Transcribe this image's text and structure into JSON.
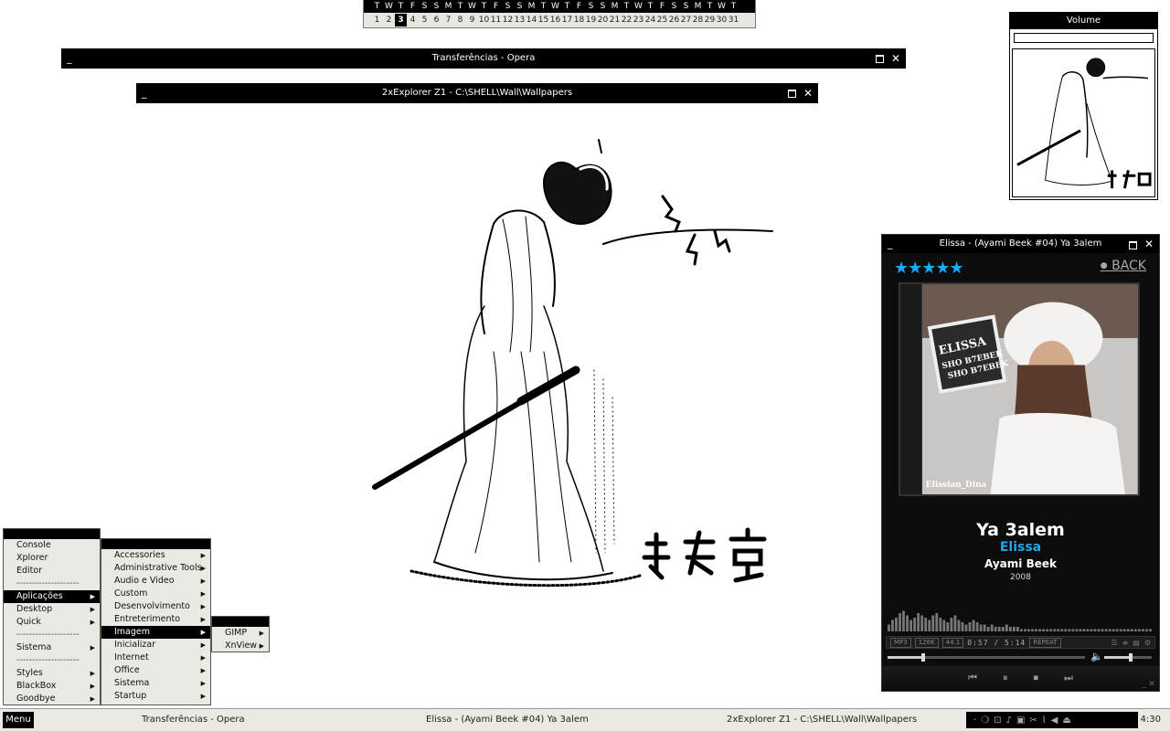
{
  "calendar": {
    "weekdays": [
      "T",
      "W",
      "T",
      "F",
      "S",
      "S",
      "M",
      "T",
      "W",
      "T",
      "F",
      "S",
      "S",
      "M",
      "T",
      "W",
      "T",
      "F",
      "S",
      "S",
      "M",
      "T",
      "W",
      "T",
      "F",
      "S",
      "S",
      "M",
      "T",
      "W",
      "T"
    ],
    "days": [
      "1",
      "2",
      "3",
      "4",
      "5",
      "6",
      "7",
      "8",
      "9",
      "10",
      "11",
      "12",
      "13",
      "14",
      "15",
      "16",
      "17",
      "18",
      "19",
      "20",
      "21",
      "22",
      "23",
      "24",
      "25",
      "26",
      "27",
      "28",
      "29",
      "30",
      "31"
    ],
    "today": "3"
  },
  "windows": {
    "opera_title": "Transferências - Opera",
    "explorer_title": "2xExplorer Z1 - C:\\SHELL\\Wall\\Wallpapers",
    "min_glyph": "_",
    "close_glyph": "✕"
  },
  "volume": {
    "title": "Volume",
    "level": 1.0
  },
  "player": {
    "title": "Elissa - (Ayami Beek #04) Ya 3alem",
    "rating": 5,
    "stars": "★★★★★",
    "back_dot": "●",
    "back_label": "BACK",
    "art_text_1": "ELISSA",
    "art_text_2": "SHO B7EBEK",
    "art_text_3": "SHO B7EBEK",
    "art_credit": "Elissian_Dina",
    "track": "Ya 3alem",
    "artist": "Elissa",
    "album": "Ayami Beek",
    "year": "2008",
    "format": "MP3",
    "bitrate": "128K",
    "samplerate": "44.1",
    "time": "0:57 / 5:14",
    "repeat_label": "REPEAT",
    "progress": 0.18,
    "volume": 0.55,
    "visualizer": [
      3,
      5,
      6,
      8,
      9,
      7,
      5,
      6,
      8,
      7,
      6,
      5,
      7,
      8,
      6,
      5,
      4,
      6,
      7,
      5,
      4,
      3,
      4,
      5,
      4,
      3,
      3,
      2,
      3,
      2,
      2,
      2,
      3,
      2,
      2,
      2,
      1,
      1,
      1,
      1,
      1,
      1,
      1,
      1,
      1,
      1,
      1,
      1,
      1,
      1,
      1,
      1,
      1,
      1,
      1,
      1,
      1,
      1,
      1,
      1,
      1,
      1,
      1,
      1,
      1,
      1,
      1,
      1,
      1,
      1,
      1,
      1
    ],
    "controls": [
      "⏮",
      "⏸",
      "⏹",
      "⏭"
    ],
    "foot": "_ ✕"
  },
  "menus": {
    "main": [
      {
        "label": "Console",
        "submenu": false
      },
      {
        "label": "Xplorer",
        "submenu": false
      },
      {
        "label": "Editor",
        "submenu": false
      },
      {
        "label": "--------------------",
        "submenu": false,
        "separator": true
      },
      {
        "label": "Aplicações",
        "submenu": true,
        "active": true
      },
      {
        "label": "Desktop",
        "submenu": true
      },
      {
        "label": "Quick",
        "submenu": true
      },
      {
        "label": "--------------------",
        "submenu": false,
        "separator": true
      },
      {
        "label": "Sistema",
        "submenu": true
      },
      {
        "label": "--------------------",
        "submenu": false,
        "separator": true
      },
      {
        "label": "Styles",
        "submenu": true
      },
      {
        "label": "BlackBox",
        "submenu": true
      },
      {
        "label": "Goodbye",
        "submenu": true
      }
    ],
    "apps": [
      {
        "label": "Accessories"
      },
      {
        "label": "Administrative Tools"
      },
      {
        "label": "Audio e Video"
      },
      {
        "label": "Custom"
      },
      {
        "label": "Desenvolvimento"
      },
      {
        "label": "Entreterimento"
      },
      {
        "label": "Imagem",
        "active": true
      },
      {
        "label": "Inicializar"
      },
      {
        "label": "Internet"
      },
      {
        "label": "Office"
      },
      {
        "label": "Sistema"
      },
      {
        "label": "Startup"
      }
    ],
    "imagem": [
      {
        "label": "GIMP"
      },
      {
        "label": "XnView"
      }
    ]
  },
  "taskbar": {
    "menu_label": "Menu",
    "tasks": [
      "Transferências - Opera",
      "Elissa - (Ayami Beek #04) Ya 3alem",
      "2xExplorer Z1 - C:\\SHELL\\Wall\\Wallpapers"
    ],
    "tray_icons": [
      "dot-icon",
      "flame-icon",
      "network-icon",
      "sound-icon",
      "window-icon",
      "tools-icon",
      "wifi-icon",
      "speaker-icon",
      "eject-icon"
    ],
    "clock": "4:30"
  },
  "colors": {
    "accent_blue": "#1ea7ff",
    "titlebar": "#000000",
    "panel": "#ebe9e3"
  }
}
